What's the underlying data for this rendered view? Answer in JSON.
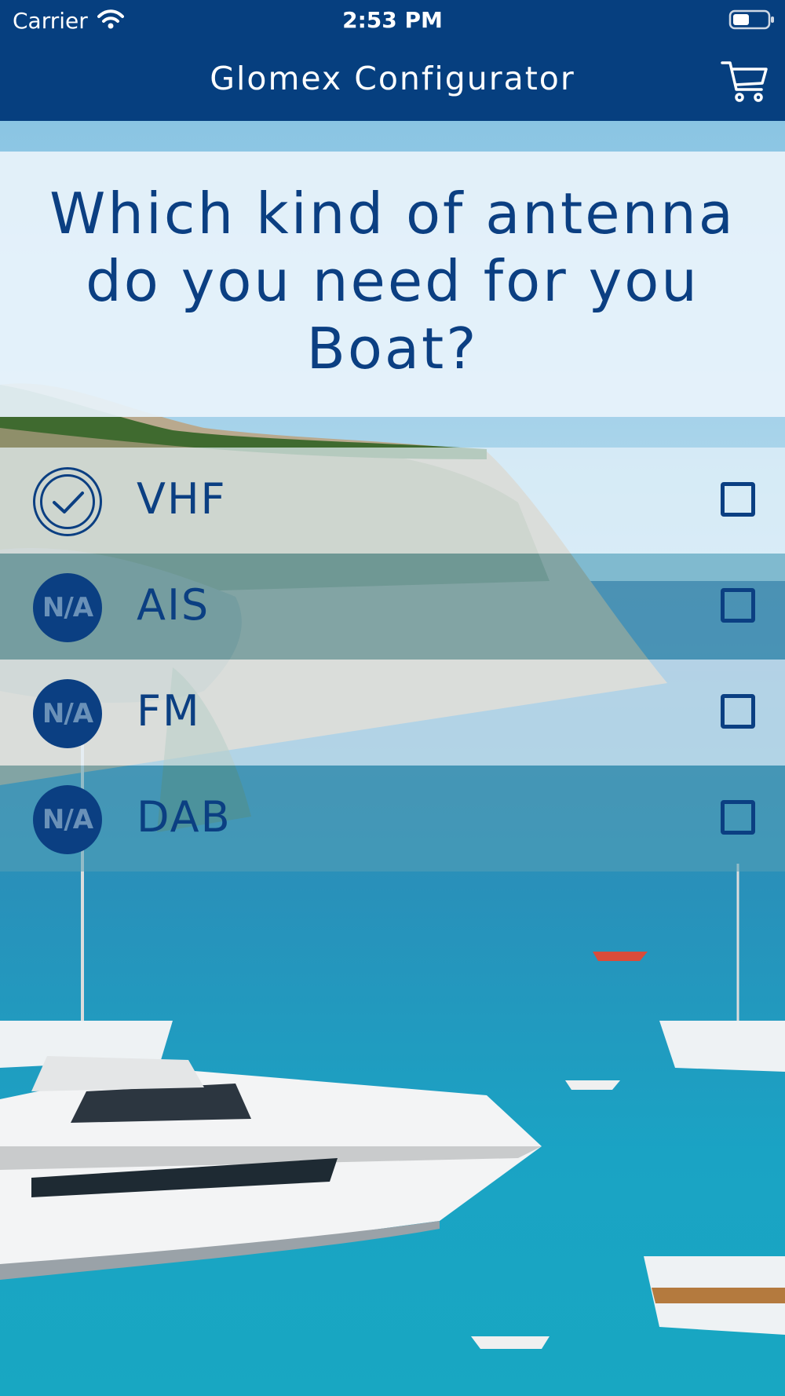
{
  "status_bar": {
    "carrier": "Carrier",
    "time": "2:53 PM"
  },
  "header": {
    "title": "Glomex Configurator",
    "cart_icon": "cart-icon"
  },
  "question": {
    "text": "Which kind of antenna do you need for you Boat?"
  },
  "options": [
    {
      "label": "VHF",
      "badge": "",
      "badge_icon": "check-circle-icon",
      "checked": false
    },
    {
      "label": "AIS",
      "badge": "N/A",
      "checked": false
    },
    {
      "label": "FM",
      "badge": "N/A",
      "checked": false
    },
    {
      "label": "DAB",
      "badge": "N/A",
      "checked": false
    }
  ],
  "colors": {
    "brand": "#063f7f",
    "text": "#0b3f82"
  }
}
